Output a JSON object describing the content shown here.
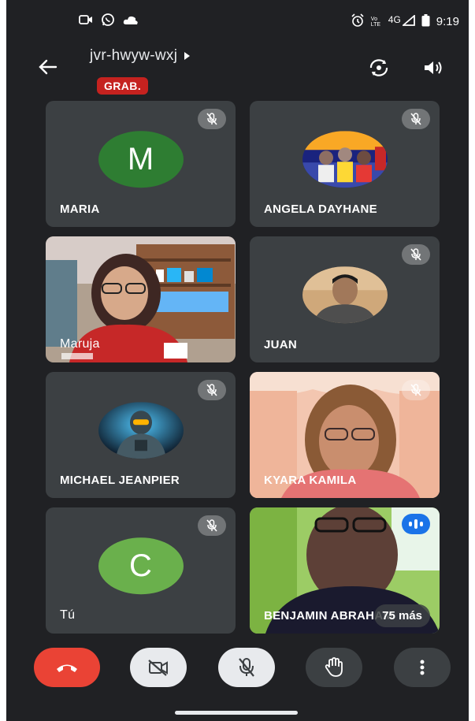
{
  "status_bar": {
    "time": "9:19",
    "network": "4G",
    "volte": "Vo LTE",
    "left_icons": [
      "video-call-icon",
      "whatsapp-icon",
      "cloud-icon"
    ],
    "right_icons": [
      "alarm-icon",
      "volte-icon",
      "signal-icon",
      "battery-icon"
    ]
  },
  "header": {
    "meeting_code": "jvr-hwyw-wxj",
    "recording_label": "GRAB.",
    "icons": [
      "back-arrow-icon",
      "chevron-right-icon",
      "switch-camera-icon",
      "speaker-icon"
    ]
  },
  "participants": [
    {
      "name": "MARIA",
      "avatar_letter": "M",
      "avatar_color": "#2e7d32",
      "muted": true,
      "kind": "letter"
    },
    {
      "name": "ANGELA DAYHANE",
      "muted": true,
      "kind": "photo"
    },
    {
      "name": "Maruja",
      "muted": false,
      "kind": "video"
    },
    {
      "name": "JUAN",
      "muted": true,
      "kind": "photo"
    },
    {
      "name": "MICHAEL JEANPIER",
      "muted": true,
      "kind": "photo"
    },
    {
      "name": "KYARA KAMILA",
      "muted": true,
      "kind": "video"
    },
    {
      "name": "Tú",
      "avatar_letter": "C",
      "avatar_color": "#6ab04c",
      "muted": true,
      "kind": "letter"
    },
    {
      "name": "BENJAMIN ABRAHAM",
      "muted": false,
      "speaking": true,
      "kind": "video",
      "more_label": "75 más"
    }
  ],
  "controls": {
    "icons": [
      "hang-up-icon",
      "camera-off-icon",
      "mic-off-icon",
      "raise-hand-icon",
      "more-options-icon"
    ],
    "colors": {
      "hangup": "#ea4335",
      "light": "#e8eaed",
      "dark": "#3c4043"
    }
  }
}
